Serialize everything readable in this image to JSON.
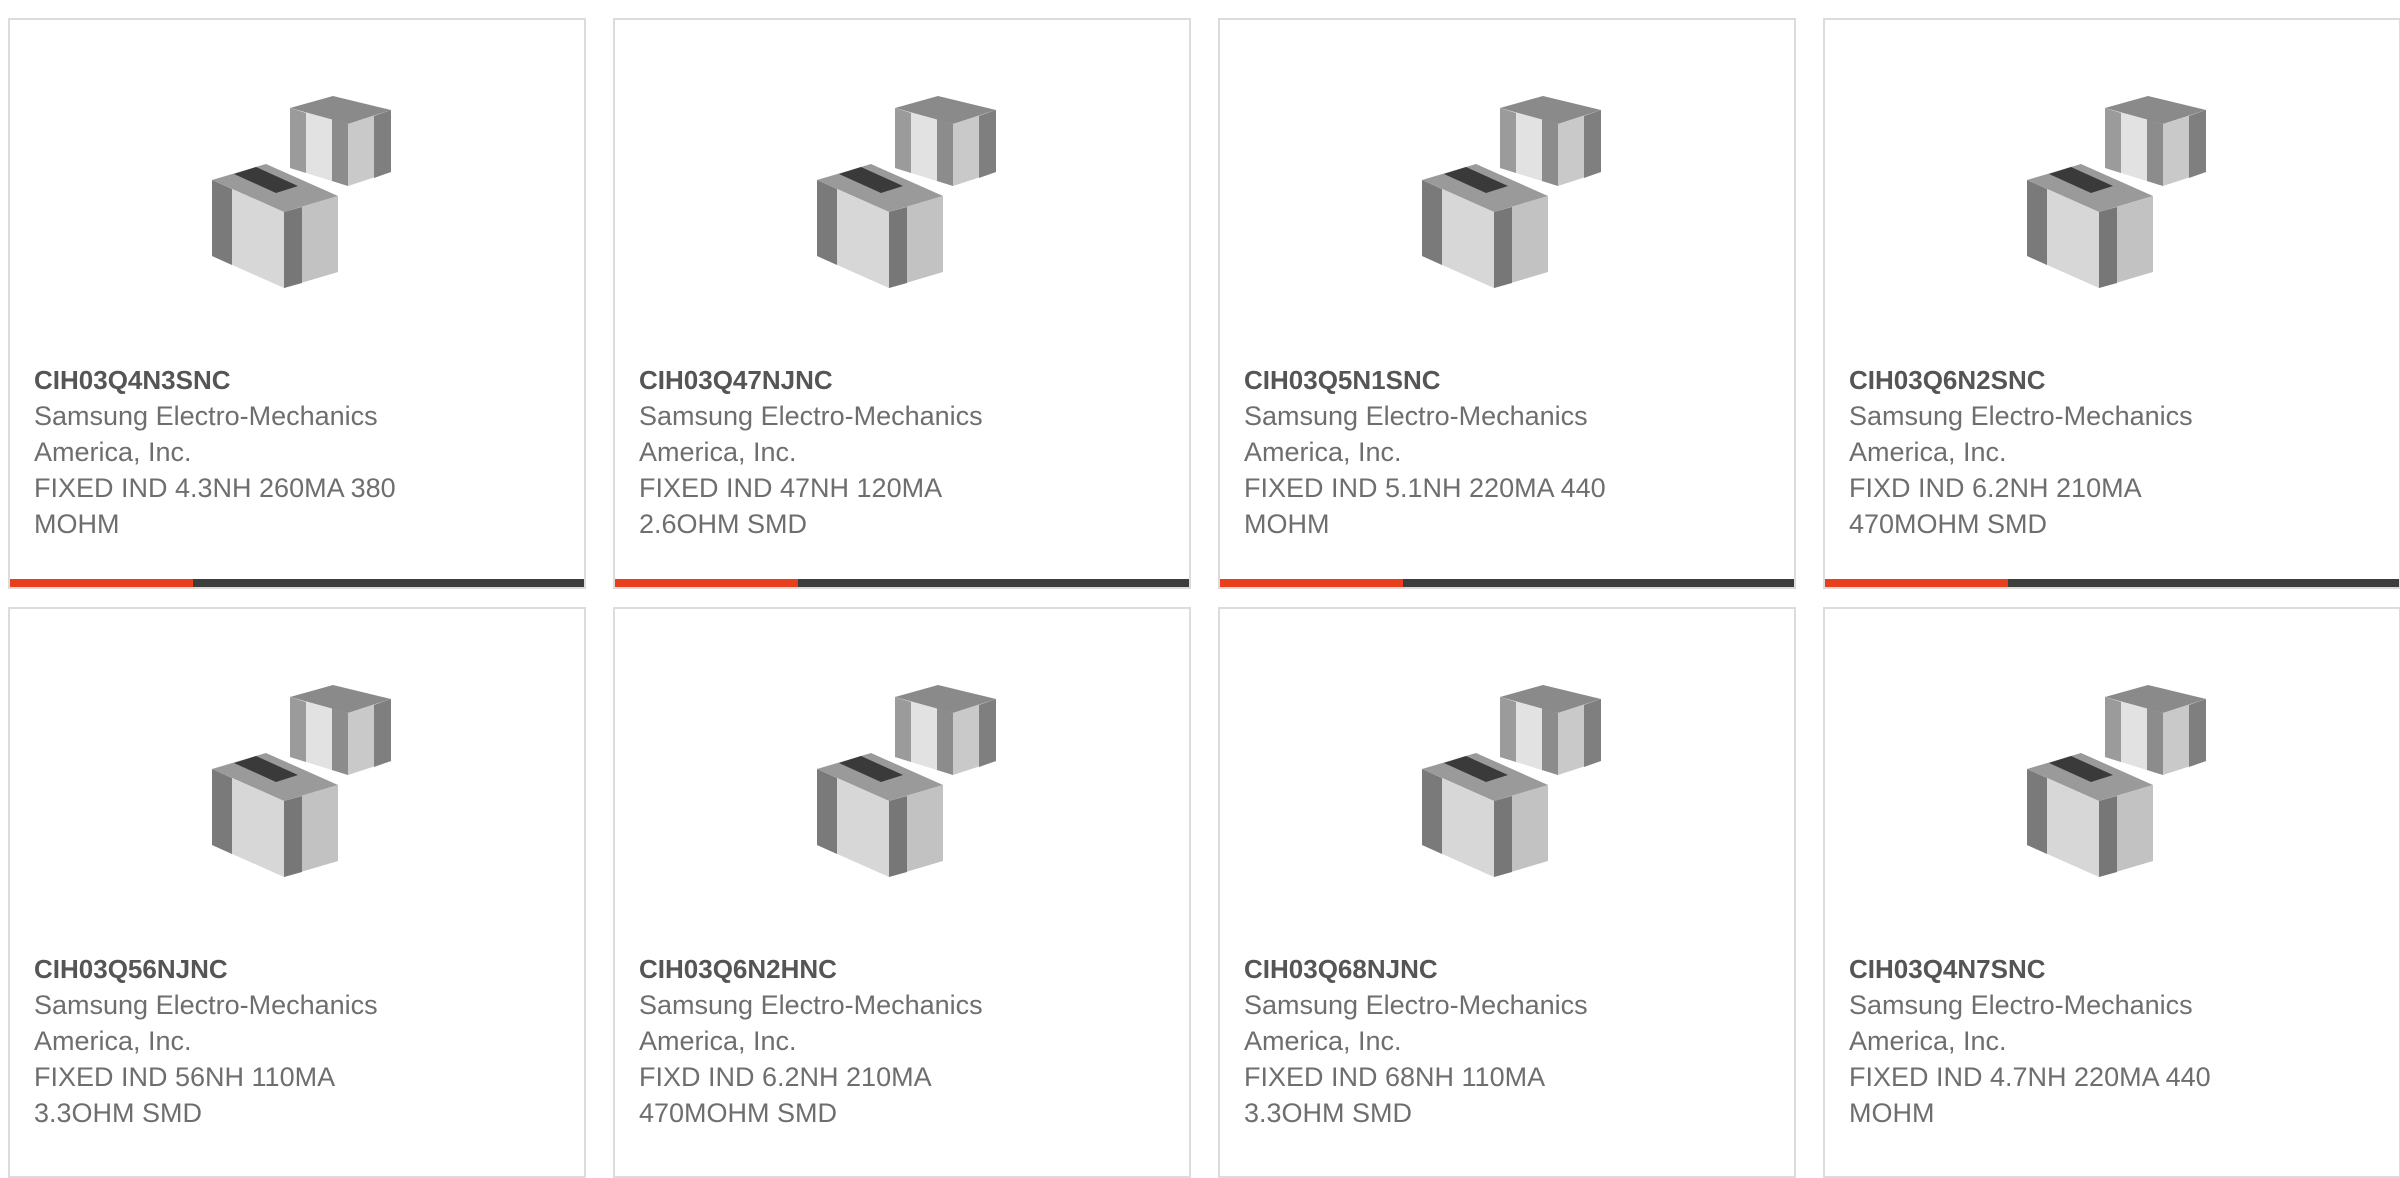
{
  "colors": {
    "accent": "#e8401c",
    "bar": "#3d3d3d",
    "border": "#dcdcdc",
    "text": "#6e6e6e"
  },
  "products": [
    {
      "part_number": "CIH03Q4N3SNC",
      "manufacturer": "Samsung Electro-Mechanics America, Inc.",
      "description": "FIXED IND 4.3NH 260MA 380 MOHM",
      "image_icon": "smd-inductor-chip-image"
    },
    {
      "part_number": "CIH03Q47NJNC",
      "manufacturer": "Samsung Electro-Mechanics America, Inc.",
      "description": "FIXED IND 47NH 120MA 2.6OHM SMD",
      "image_icon": "smd-inductor-chip-image"
    },
    {
      "part_number": "CIH03Q5N1SNC",
      "manufacturer": "Samsung Electro-Mechanics America, Inc.",
      "description": "FIXED IND 5.1NH 220MA 440 MOHM",
      "image_icon": "smd-inductor-chip-image"
    },
    {
      "part_number": "CIH03Q6N2SNC",
      "manufacturer": "Samsung Electro-Mechanics America, Inc.",
      "description": "FIXD IND 6.2NH 210MA 470MOHM SMD",
      "image_icon": "smd-inductor-chip-image"
    },
    {
      "part_number": "CIH03Q56NJNC",
      "manufacturer": "Samsung Electro-Mechanics America, Inc.",
      "description": "FIXED IND 56NH 110MA 3.3OHM SMD",
      "image_icon": "smd-inductor-chip-image"
    },
    {
      "part_number": "CIH03Q6N2HNC",
      "manufacturer": "Samsung Electro-Mechanics America, Inc.",
      "description": "FIXD IND 6.2NH 210MA 470MOHM SMD",
      "image_icon": "smd-inductor-chip-image"
    },
    {
      "part_number": "CIH03Q68NJNC",
      "manufacturer": "Samsung Electro-Mechanics America, Inc.",
      "description": "FIXED IND 68NH 110MA 3.3OHM SMD",
      "image_icon": "smd-inductor-chip-image"
    },
    {
      "part_number": "CIH03Q4N7SNC",
      "manufacturer": "Samsung Electro-Mechanics America, Inc.",
      "description": "FIXED IND 4.7NH 220MA 440 MOHM",
      "image_icon": "smd-inductor-chip-image"
    }
  ]
}
